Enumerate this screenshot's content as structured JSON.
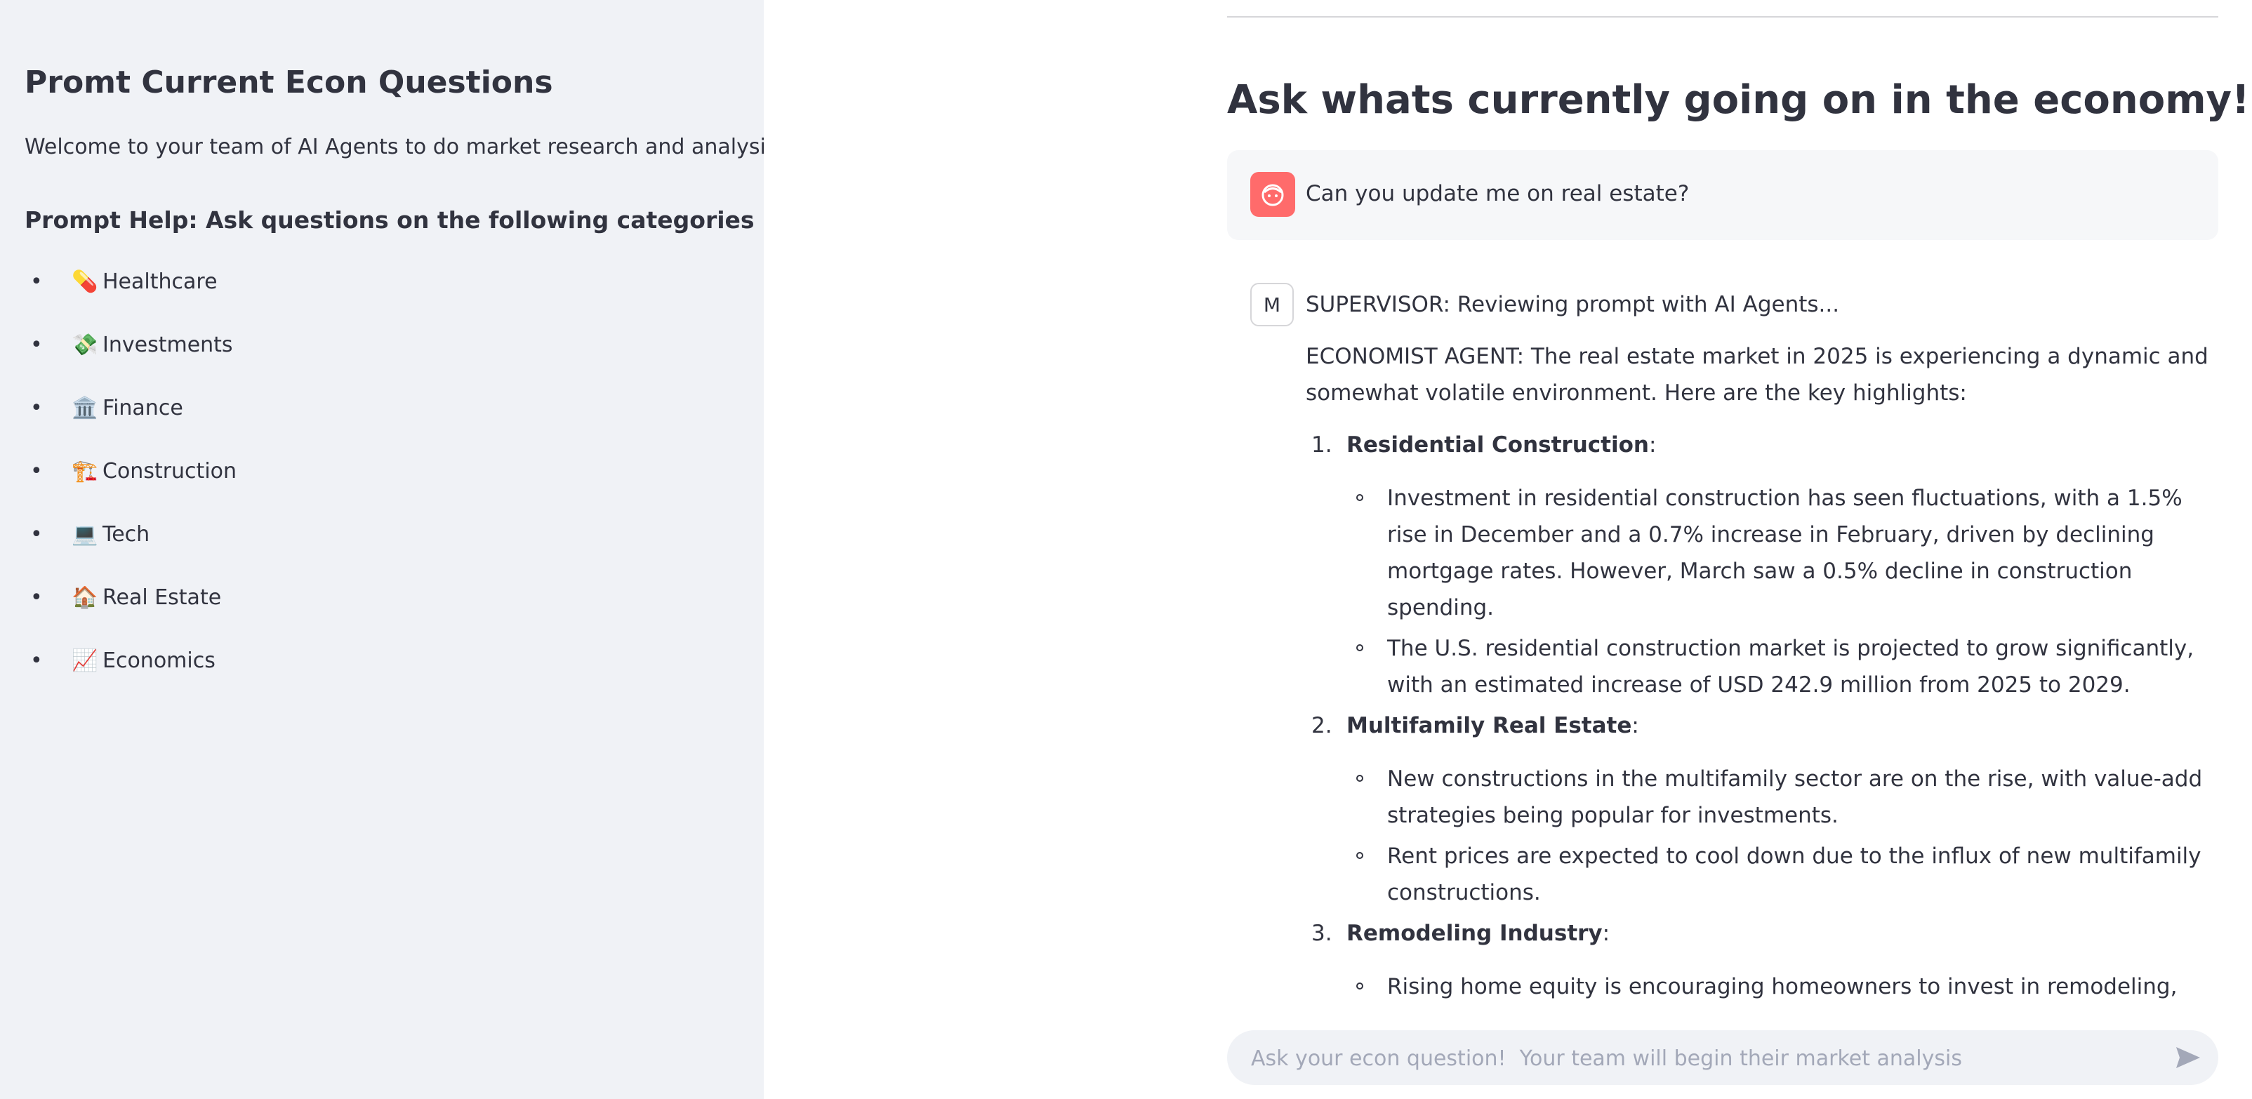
{
  "sidebar": {
    "title": "Promt Current Econ Questions",
    "welcome": "Welcome to your team of AI Agents to do market research and analysis",
    "help_heading": "Prompt Help: Ask questions on the following categories",
    "bullet": "•",
    "categories": [
      {
        "icon": "💊",
        "icon_name": "pill-icon",
        "label": "Healthcare"
      },
      {
        "icon": "💸",
        "icon_name": "money-with-wings-icon",
        "label": "Investments"
      },
      {
        "icon": "🏛️",
        "icon_name": "bank-building-icon",
        "label": "Finance"
      },
      {
        "icon": "🏗️",
        "icon_name": "construction-crane-icon",
        "label": "Construction"
      },
      {
        "icon": "💻",
        "icon_name": "laptop-icon",
        "label": "Tech"
      },
      {
        "icon": "🏠",
        "icon_name": "house-icon",
        "label": "Real Estate"
      },
      {
        "icon": "📈",
        "icon_name": "chart-increasing-icon",
        "label": "Economics"
      }
    ],
    "background": "#f0f2f6"
  },
  "main": {
    "title": "Ask whats currently going on in the economy!",
    "user_message": {
      "avatar_icon": "user-face-icon",
      "avatar_color": "#ff6b6b",
      "text": "Can you update me on real estate?"
    },
    "assistant_message": {
      "avatar_letter": "M",
      "supervisor": "SUPERVISOR: Reviewing prompt with AI Agents...",
      "economist_intro": "ECONOMIST AGENT: The real estate market in 2025 is experiencing a dynamic and somewhat volatile environment. Here are the key highlights:",
      "sections": [
        {
          "num": "1.",
          "heading": "Residential Construction",
          "colon": ":",
          "bullets": [
            "Investment in residential construction has seen fluctuations, with a 1.5% rise in December and a 0.7% increase in February, driven by declining mortgage rates. However, March saw a 0.5% decline in construction spending.",
            "The U.S. residential construction market is projected to grow significantly, with an estimated increase of USD 242.9 million from 2025 to 2029."
          ]
        },
        {
          "num": "2.",
          "heading": "Multifamily Real Estate",
          "colon": ":",
          "bullets": [
            "New constructions in the multifamily sector are on the rise, with value-add strategies being popular for investments.",
            "Rent prices are expected to cool down due to the influx of new multifamily constructions."
          ]
        },
        {
          "num": "3.",
          "heading": "Remodeling Industry",
          "colon": ":",
          "bullets": [
            "Rising home equity is encouraging homeowners to invest in remodeling, particularly in energy-efficient projects."
          ]
        }
      ]
    },
    "chat_input": {
      "placeholder": "Ask your econ question!  Your team will begin their market analysis",
      "value": "",
      "send_icon": "send-arrow-icon"
    }
  }
}
